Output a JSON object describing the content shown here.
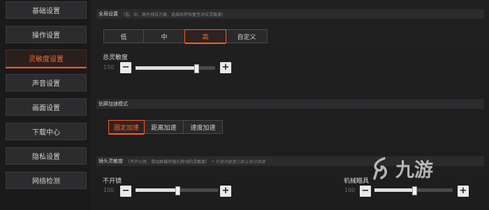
{
  "sidebar": {
    "items": [
      {
        "label": "基础设置",
        "active": false
      },
      {
        "label": "操作设置",
        "active": false
      },
      {
        "label": "灵敏度设置",
        "active": true
      },
      {
        "label": "声音设置",
        "active": false
      },
      {
        "label": "画面设置",
        "active": false
      },
      {
        "label": "下载中心",
        "active": false
      },
      {
        "label": "隐私设置",
        "active": false
      },
      {
        "label": "网络检测",
        "active": false
      }
    ]
  },
  "global": {
    "title": "全局设置",
    "note": "（低、中、高为预设方案，选择后将恢复至对应灵敏度）",
    "presets": [
      "低",
      "中",
      "高",
      "自定义"
    ],
    "active_preset": "高"
  },
  "overall": {
    "label": "总灵敏度",
    "value": "150",
    "minus": "−",
    "plus": "+",
    "level": 0.75
  },
  "swipe": {
    "title": "划屏加速模式",
    "options": [
      "固定加速",
      "距离加速",
      "速度加速"
    ],
    "active_option": "固定加速"
  },
  "lens": {
    "title": "镜头灵敏度",
    "note": "（不开火时，滑动屏幕时镜头转动的灵敏度）",
    "note2": "* 开镜灵敏度已默认按过换算",
    "left_label": "不开镜",
    "left_value": "100",
    "right_label": "机械瞄具",
    "right_value": "100",
    "left_level": 0.5,
    "right_level": 0.5
  },
  "watermark": {
    "text": "九游",
    "icon": "jiuyou-logo-icon"
  },
  "colors": {
    "accent": "#ff5a1f",
    "background": "#1c1c1d",
    "panel": "#2b2b2d"
  }
}
